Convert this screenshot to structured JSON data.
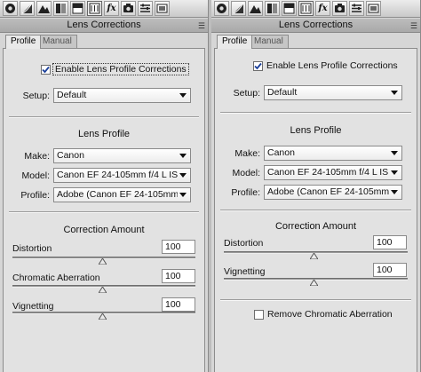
{
  "left_panel": {
    "title": "Lens Corrections",
    "tabs": [
      "Profile",
      "Manual"
    ],
    "enable_label": "Enable Lens Profile Corrections",
    "enable_checked": true,
    "setup_label": "Setup:",
    "setup_value": "Default",
    "lens_profile_heading": "Lens Profile",
    "make_label": "Make:",
    "make_value": "Canon",
    "model_label": "Model:",
    "model_value": "Canon EF 24-105mm f/4 L IS ...",
    "profile_label": "Profile:",
    "profile_value": "Adobe (Canon EF 24-105mm f...",
    "correction_heading": "Correction Amount",
    "sliders": [
      {
        "label": "Distortion",
        "value": "100"
      },
      {
        "label": "Chromatic Aberration",
        "value": "100"
      },
      {
        "label": "Vignetting",
        "value": "100"
      }
    ]
  },
  "right_panel": {
    "title": "Lens Corrections",
    "tabs": [
      "Profile",
      "Manual"
    ],
    "enable_label": "Enable Lens Profile Corrections",
    "enable_checked": true,
    "setup_label": "Setup:",
    "setup_value": "Default",
    "lens_profile_heading": "Lens Profile",
    "make_label": "Make:",
    "make_value": "Canon",
    "model_label": "Model:",
    "model_value": "Canon EF 24-105mm f/4 L IS ...",
    "profile_label": "Profile:",
    "profile_value": "Adobe (Canon EF 24-105mm f...",
    "correction_heading": "Correction Amount",
    "sliders": [
      {
        "label": "Distortion",
        "value": "100"
      },
      {
        "label": "Vignetting",
        "value": "100"
      }
    ],
    "remove_ca_label": "Remove Chromatic Aberration",
    "remove_ca_checked": false
  },
  "toolbar_icons": [
    "aperture-icon",
    "tone-curve-icon",
    "mountain-icon",
    "split-panel-icon",
    "hsl-panel-icon",
    "lens-panel-icon",
    "fx-icon",
    "camera-icon",
    "presets-icon",
    "snapshots-icon"
  ],
  "fx_text": "fx"
}
